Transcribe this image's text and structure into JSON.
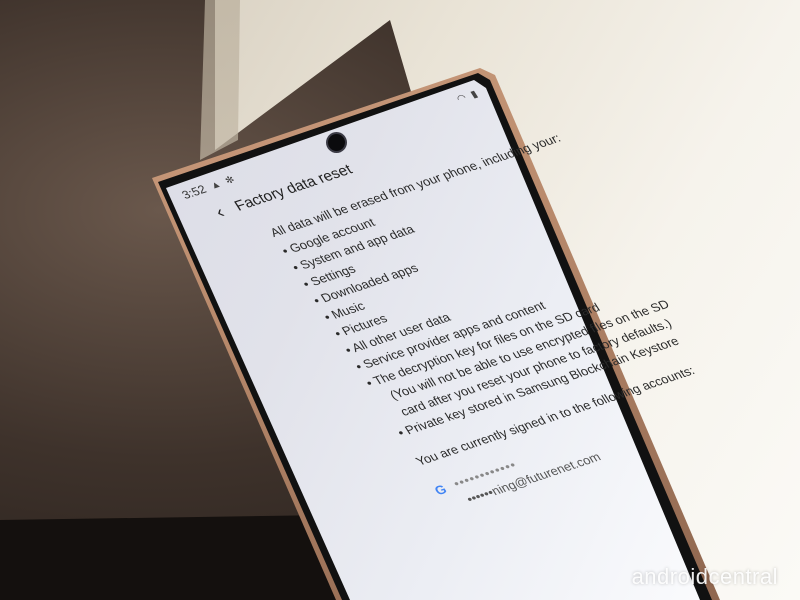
{
  "status_bar": {
    "time": "3:52"
  },
  "app_bar": {
    "title": "Factory data reset"
  },
  "intro": "All data will be erased from your phone, including your:",
  "items": [
    "Google account",
    "System and app data",
    "Settings",
    "Downloaded apps",
    "Music",
    "Pictures",
    "All other user data",
    "Service provider apps and content",
    "The decryption key for files on the SD card"
  ],
  "note_lines": [
    "(You will not be able to use encrypted files on the SD",
    "card after you reset your phone to factory defaults.)"
  ],
  "private_key_item": "Private key stored in Samsung Blockchain Keystore",
  "signed_in_text": "You are currently signed in to the following accounts:",
  "account": {
    "name": "••••••••••••",
    "email": "••••••ning@futurenet.com"
  },
  "watermark": "androidcentral",
  "icons": [
    "back-arrow-icon",
    "google-icon",
    "navigation-icon",
    "wifi-icon",
    "battery-icon"
  ]
}
